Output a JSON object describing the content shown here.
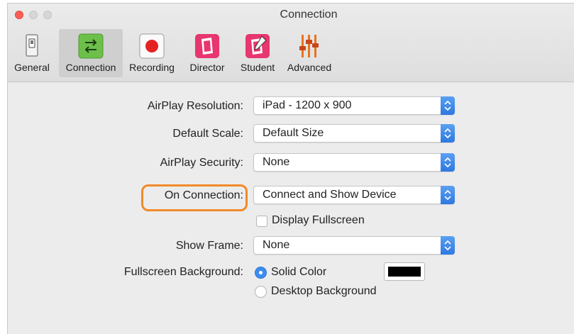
{
  "window": {
    "title": "Connection"
  },
  "toolbar": {
    "items": [
      {
        "label": "General",
        "icon": "light-switch-icon"
      },
      {
        "label": "Connection",
        "icon": "exchange-arrows-icon",
        "selected": true
      },
      {
        "label": "Recording",
        "icon": "record-icon"
      },
      {
        "label": "Director",
        "icon": "director-app-icon"
      },
      {
        "label": "Student",
        "icon": "student-app-icon"
      },
      {
        "label": "Advanced",
        "icon": "sliders-icon"
      }
    ]
  },
  "settings": {
    "airplay_resolution": {
      "label": "AirPlay Resolution:",
      "value": "iPad - 1200 x 900"
    },
    "default_scale": {
      "label": "Default Scale:",
      "value": "Default Size"
    },
    "airplay_security": {
      "label": "AirPlay Security:",
      "value": "None"
    },
    "on_connection": {
      "label": "On Connection:",
      "value": "Connect and Show Device"
    },
    "display_fullscreen": {
      "label": "Display Fullscreen",
      "checked": false
    },
    "show_frame": {
      "label": "Show Frame:",
      "value": "None"
    },
    "fullscreen_background": {
      "label": "Fullscreen Background:",
      "options": [
        "Solid Color",
        "Desktop Background"
      ],
      "selected": "Solid Color",
      "color": "#000000"
    }
  },
  "colors": {
    "accent": "#3d8cf0",
    "highlight": "#f08a2a"
  }
}
